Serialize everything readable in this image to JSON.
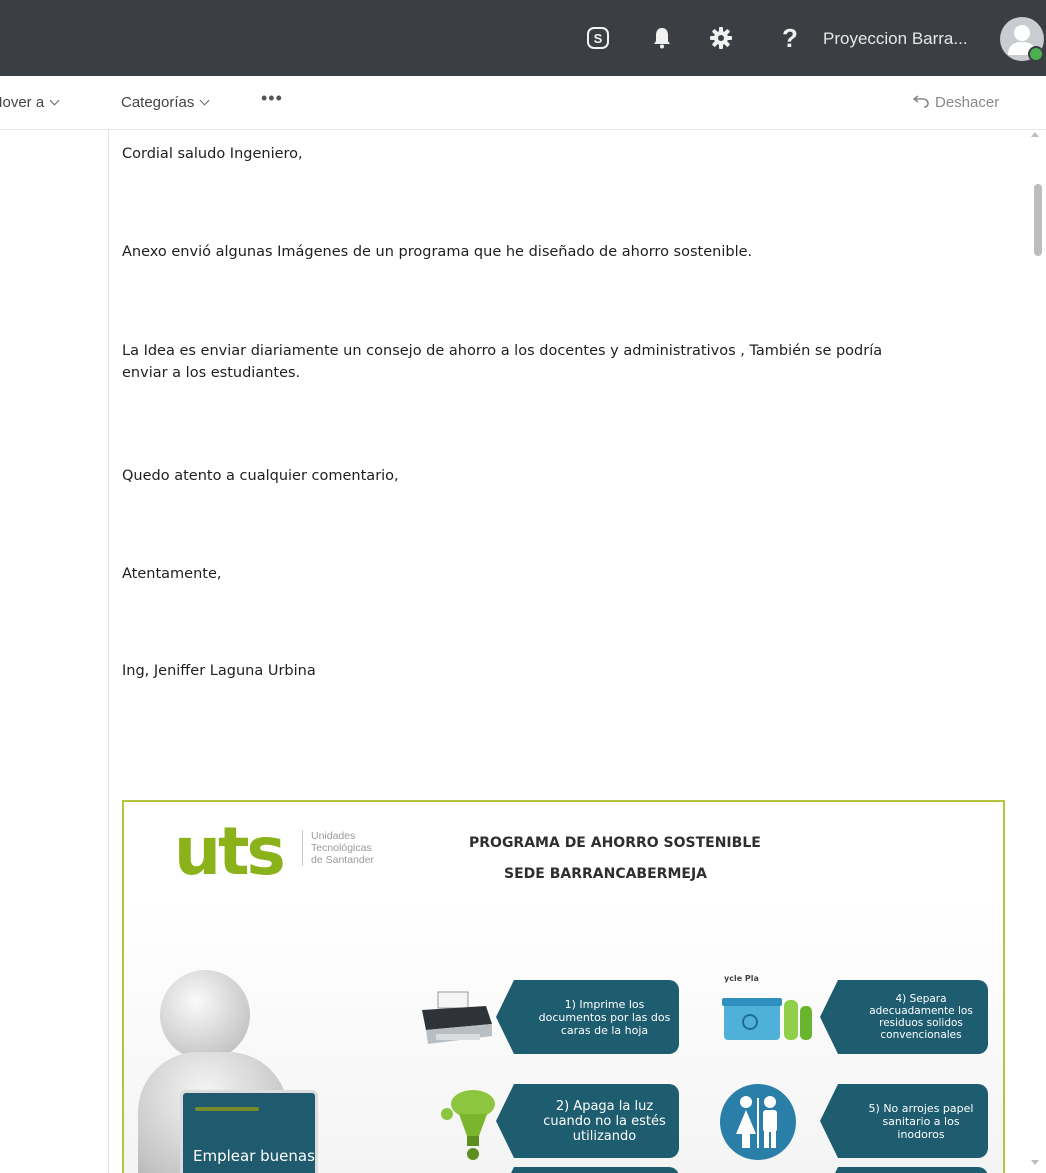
{
  "header": {
    "user_name": "Proyeccion Barra...",
    "help_glyph": "?"
  },
  "command_bar": {
    "move_label": "Mover a",
    "categories_label": "Categorías",
    "more_label": "•••",
    "undo_label": "Deshacer"
  },
  "message": {
    "greeting": "Cordial saludo Ingeniero,",
    "paragraph1": "Anexo envió algunas Imágenes de un programa que he diseñado de ahorro sostenible.",
    "paragraph2_line1": "La Idea es enviar diariamente un consejo de ahorro a los docentes y administrativos , También se podría",
    "paragraph2_line2": "enviar a los estudiantes.",
    "paragraph3": "Quedo atento a cualquier comentario,",
    "closing": "Atentamente,",
    "signature": "Ing, Jeniffer Laguna Urbina"
  },
  "attachment_image": {
    "logo_text": "uts",
    "logo_sub": [
      "Unidades",
      "Tecnológicas",
      "de Santander"
    ],
    "title": "PROGRAMA DE AHORRO SOSTENIBLE",
    "subtitle": "SEDE BARRANCABERMEJA",
    "board_text": "Emplear buenas",
    "bins_label": "ycle Pla",
    "tips": {
      "tip1": "1) Imprime los documentos por las dos caras de la hoja",
      "tip2": "2) Apaga la luz cuando no la estés utilizando",
      "tip4": "4) Separa adecuadamente los residuos solidos convencionales",
      "tip5": "5) No arrojes papel sanitario a los inodoros"
    }
  },
  "colors": {
    "topbar": "#3b3f44",
    "tip_card": "#1e5c70",
    "uts_green": "#8bb21a",
    "image_border": "#b5c43a",
    "presence": "#4caf50"
  }
}
